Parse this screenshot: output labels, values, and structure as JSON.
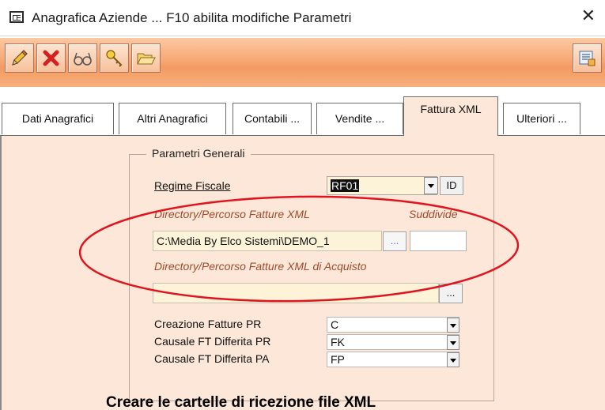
{
  "window": {
    "title": "Anagrafica Aziende ... F10 abilita modifiche Parametri",
    "close_glyph": "✕"
  },
  "toolbar": {
    "buttons": [
      {
        "icon": "pencil-icon"
      },
      {
        "icon": "delete-x-icon"
      },
      {
        "icon": "glasses-icon"
      },
      {
        "icon": "key-icon"
      },
      {
        "icon": "open-folder-icon"
      }
    ],
    "right_button": {
      "icon": "notes-icon"
    }
  },
  "tabs": [
    {
      "label": "Dati Anagrafici",
      "active": false
    },
    {
      "label": "Altri Anagrafici",
      "active": false
    },
    {
      "label": "Contabili ...",
      "active": false
    },
    {
      "label": "Vendite ...",
      "active": false
    },
    {
      "label": "Fattura XML",
      "active": true
    },
    {
      "label": "Ulteriori ...",
      "active": false
    }
  ],
  "group": {
    "title": "Parametri Generali",
    "regime": {
      "label": "Regime Fiscale",
      "value": "RF01",
      "id_button": "ID"
    },
    "dir_xml": {
      "label": "Directory/Percorso Fatture XML",
      "side_label": "Suddivide",
      "value": "C:\\Media By Elco Sistemi\\DEMO_1",
      "browse": "..."
    },
    "dir_xml_acq": {
      "label": "Directory/Percorso Fatture XML di Acquisto",
      "value": "",
      "browse": "..."
    },
    "rows": [
      {
        "label": "Creazione Fatture PR",
        "value": "C"
      },
      {
        "label": "Causale FT Differita PR",
        "value": "FK"
      },
      {
        "label": "Causale FT Differita PA",
        "value": "FP"
      }
    ]
  },
  "caption": "Creare le cartelle di ricezione file XML",
  "colors": {
    "toolbar": "#f49a62",
    "panel": "#fde7d8",
    "field": "#fdf3d8",
    "annotation": "#e0141e"
  }
}
